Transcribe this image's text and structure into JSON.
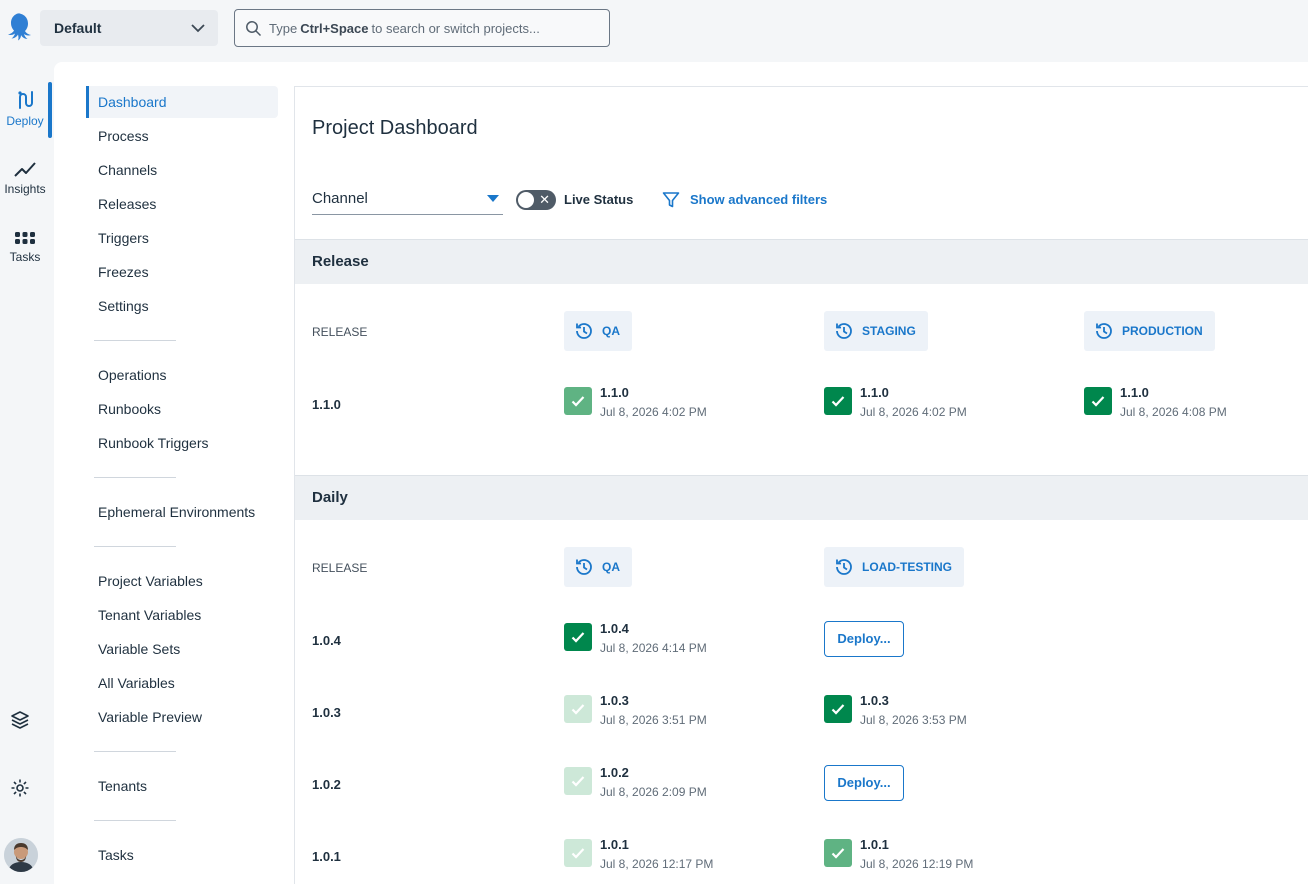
{
  "topbar": {
    "space_name": "Default",
    "search_prefix": "Type",
    "search_shortcut": "Ctrl+Space",
    "search_suffix": "to search or switch projects..."
  },
  "rail": {
    "deploy": "Deploy",
    "insights": "Insights",
    "tasks": "Tasks"
  },
  "sidenav": {
    "items": [
      "Dashboard",
      "Process",
      "Channels",
      "Releases",
      "Triggers",
      "Freezes",
      "Settings",
      "Operations",
      "Runbooks",
      "Runbook Triggers",
      "Ephemeral Environments",
      "Project Variables",
      "Tenant Variables",
      "Variable Sets",
      "All Variables",
      "Variable Preview",
      "Tenants",
      "Tasks"
    ],
    "active": "Dashboard"
  },
  "main": {
    "title": "Project Dashboard",
    "channel_label": "Channel",
    "live_status": "Live Status",
    "live_status_on": false,
    "advanced_filters": "Show advanced filters"
  },
  "groups": [
    {
      "name": "Release",
      "column_label": "RELEASE",
      "environments": [
        "QA",
        "STAGING",
        "PRODUCTION"
      ],
      "rows": [
        {
          "release": "1.1.0",
          "cells": [
            {
              "type": "deployed",
              "version": "1.1.0",
              "date": "Jul 8, 2026 4:02 PM",
              "shade": "mid"
            },
            {
              "type": "deployed",
              "version": "1.1.0",
              "date": "Jul 8, 2026 4:02 PM",
              "shade": "dark"
            },
            {
              "type": "deployed",
              "version": "1.1.0",
              "date": "Jul 8, 2026 4:08 PM",
              "shade": "dark"
            }
          ]
        }
      ]
    },
    {
      "name": "Daily",
      "column_label": "RELEASE",
      "environments": [
        "QA",
        "LOAD-TESTING"
      ],
      "rows": [
        {
          "release": "1.0.4",
          "cells": [
            {
              "type": "deployed",
              "version": "1.0.4",
              "date": "Jul 8, 2026 4:14 PM",
              "shade": "dark"
            },
            {
              "type": "button",
              "label": "Deploy..."
            }
          ]
        },
        {
          "release": "1.0.3",
          "cells": [
            {
              "type": "deployed",
              "version": "1.0.3",
              "date": "Jul 8, 2026 3:51 PM",
              "shade": "light"
            },
            {
              "type": "deployed",
              "version": "1.0.3",
              "date": "Jul 8, 2026 3:53 PM",
              "shade": "dark"
            }
          ]
        },
        {
          "release": "1.0.2",
          "cells": [
            {
              "type": "deployed",
              "version": "1.0.2",
              "date": "Jul 8, 2026 2:09 PM",
              "shade": "light"
            },
            {
              "type": "button",
              "label": "Deploy..."
            }
          ]
        },
        {
          "release": "1.0.1",
          "cells": [
            {
              "type": "deployed",
              "version": "1.0.1",
              "date": "Jul 8, 2026 12:17 PM",
              "shade": "light"
            },
            {
              "type": "deployed",
              "version": "1.0.1",
              "date": "Jul 8, 2026 12:19 PM",
              "shade": "mid"
            }
          ]
        }
      ]
    }
  ],
  "colors": {
    "accent": "#1a77ca",
    "success_dark": "#00874d",
    "success_mid": "#5fb383",
    "success_light": "#cde8d8"
  }
}
